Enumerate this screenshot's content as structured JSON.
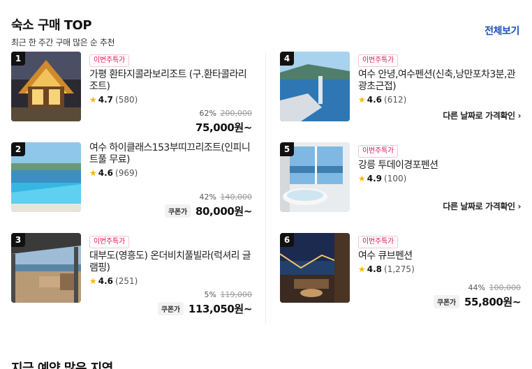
{
  "section": {
    "title": "숙소 구매 TOP",
    "subtitle": "최근 한 주간 구매 많은 순 추천",
    "view_all": "전체보기"
  },
  "cards": [
    {
      "rank": "1",
      "badge": "이번주특가",
      "name": "가평 환타지콜라보리조트 (구.환타콜라리조트)",
      "score": "4.7",
      "reviews": "(580)",
      "discount": "62%",
      "original": "200,000",
      "coupon": "",
      "price": "75,000원~",
      "link": ""
    },
    {
      "rank": "2",
      "badge": "",
      "name": "여수 하이클래스153부띠끄리조트(인피니트풀 무료)",
      "score": "4.6",
      "reviews": "(969)",
      "discount": "42%",
      "original": "140,000",
      "coupon": "쿠폰가",
      "price": "80,000원~",
      "link": ""
    },
    {
      "rank": "3",
      "badge": "이번주특가",
      "name": "대부도(영흥도) 온더비치풀빌라(럭셔리 글램핑)",
      "score": "4.6",
      "reviews": "(251)",
      "discount": "5%",
      "original": "119,000",
      "coupon": "쿠폰가",
      "price": "113,050원~",
      "link": ""
    },
    {
      "rank": "4",
      "badge": "이번주특가",
      "name": "여수 안녕,여수펜션(신축,낭만포차3분,관광초근접)",
      "score": "4.6",
      "reviews": "(612)",
      "discount": "",
      "original": "",
      "coupon": "",
      "price": "",
      "link": "다른 날짜로 가격확인"
    },
    {
      "rank": "5",
      "badge": "이번주특가",
      "name": "강릉 투데이경포펜션",
      "score": "4.9",
      "reviews": "(100)",
      "discount": "",
      "original": "",
      "coupon": "",
      "price": "",
      "link": "다른 날짜로 가격확인"
    },
    {
      "rank": "6",
      "badge": "이번주특가",
      "name": "여수 큐브펜션",
      "score": "4.8",
      "reviews": "(1,275)",
      "discount": "44%",
      "original": "100,000",
      "coupon": "쿠폰가",
      "price": "55,800원~",
      "link": ""
    }
  ],
  "next_section": {
    "title": "지금 예약 많은 지역"
  },
  "icons": {
    "star": "star-icon",
    "chevron": "chevron-right-icon"
  },
  "colors": {
    "accent": "#1d4fb8",
    "badge": "#e8114f",
    "star": "#f5b800"
  }
}
